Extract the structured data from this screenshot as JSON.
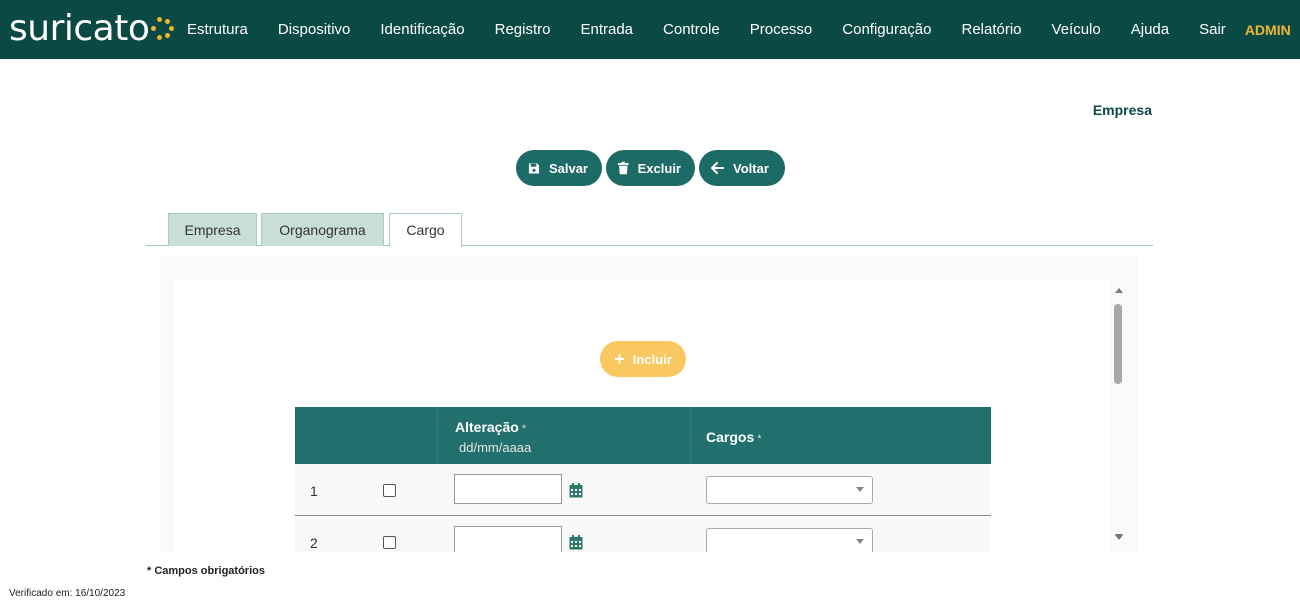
{
  "app": {
    "logo_text": "suricato",
    "nav": [
      "Estrutura",
      "Dispositivo",
      "Identificação",
      "Registro",
      "Entrada",
      "Controle",
      "Processo",
      "Configuração",
      "Relatório",
      "Veículo",
      "Ajuda",
      "Sair"
    ],
    "user": "ADMIN"
  },
  "page": {
    "title": "Empresa"
  },
  "toolbar": {
    "save_label": "Salvar",
    "delete_label": "Excluir",
    "back_label": "Voltar"
  },
  "tabs": [
    {
      "label": "Empresa",
      "active": false
    },
    {
      "label": "Organograma",
      "active": false
    },
    {
      "label": "Cargo",
      "active": true
    }
  ],
  "panel": {
    "add_label": "Incluir"
  },
  "table": {
    "columns": {
      "alteracao": "Alteração",
      "alteracao_hint": "dd/mm/aaaa",
      "cargos": "Cargos",
      "required_mark": "*"
    },
    "rows": [
      {
        "num": "1",
        "date": "",
        "cargo": ""
      },
      {
        "num": "2",
        "date": "",
        "cargo": ""
      }
    ]
  },
  "footer": {
    "required_note": "* Campos obrigatórios",
    "verified": "Verificado em: 16/10/2023"
  },
  "colors": {
    "topbar": "#0b4a44",
    "primary_button": "#1d6b67",
    "add_button": "#f9c860",
    "accent_admin": "#f2b530",
    "table_header": "#22706d"
  },
  "icons": {
    "save": "floppy-disk-icon",
    "delete": "trash-icon",
    "back": "arrow-left-icon",
    "add": "plus-icon",
    "calendar": "calendar-icon"
  }
}
